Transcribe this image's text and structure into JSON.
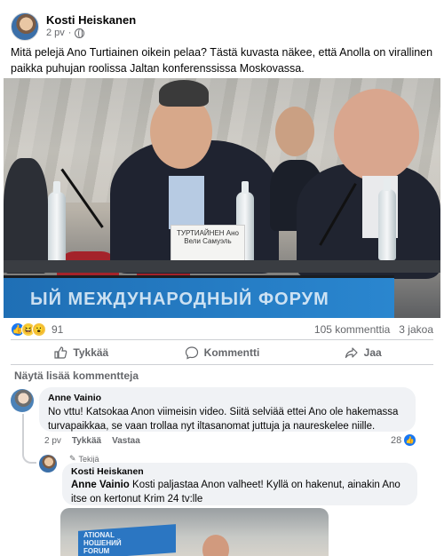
{
  "post": {
    "author": "Kosti Heiskanen",
    "time": "2 pv",
    "separator": "·",
    "text": "Mitä pelejä Ano Turtiainen oikein pelaa? Tästä kuvasta näkee, että Anolla on virallinen paikka puhujan roolissa Jaltan konferenssissa Moskovassa.",
    "photo": {
      "banner_text": "ЫЙ МЕЖДУНАРОДНЫЙ ФОРУМ",
      "namecard_text": "ТУРТИАЙНЕН Ано Вели Самуэль"
    }
  },
  "reactions": {
    "count": "91",
    "comments": "105 kommenttia",
    "shares": "3 jakoa"
  },
  "actions": {
    "like": "Tykkää",
    "comment": "Kommentti",
    "share": "Jaa"
  },
  "comments_section": {
    "show_more": "Näytä lisää kommentteja"
  },
  "comments": [
    {
      "name": "Anne Vainio",
      "text": "No vttu! Katsokaa Anon viimeisin video. Siitä selviää ettei Ano ole hakemassa turvapaikkaa, se vaan trollaa nyt iltasanomat juttuja ja naureskelee niille.",
      "time": "2 pv",
      "like": "Tykkää",
      "reply": "Vastaa",
      "likes": "28"
    }
  ],
  "reply": {
    "tag": "Tekijä",
    "name": "Kosti Heiskanen",
    "mention": "Anne Vainio",
    "text": " Kosti paljastaa Anon valheet! Kyllä on hakenut, ainakin Ano itse on kertonut Krim 24 tv:lle",
    "thumb_text": "ATIONAL\nНОШЕНИЙ\nFORUM"
  },
  "colors": {
    "brand": "#1877f2",
    "muted": "#65676b",
    "bubble": "#f0f2f5"
  },
  "icons": [
    "globe-icon",
    "more-icon",
    "like-icon",
    "comment-icon",
    "share-icon",
    "pencil-icon"
  ]
}
